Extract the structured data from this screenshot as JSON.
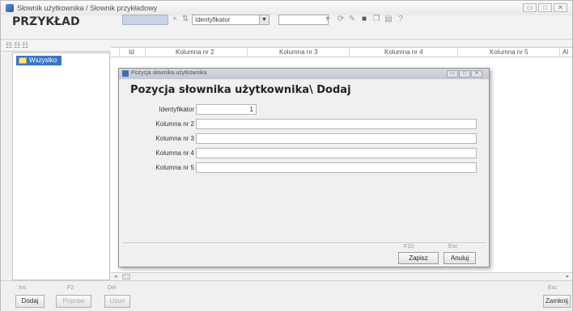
{
  "window": {
    "title": "Słownik użytkownika / Słownik przykładowy",
    "buttons": [
      "▭",
      "□",
      "✕"
    ]
  },
  "brand": "PRZYKŁAD",
  "toolbar": {
    "field_select": "Identyfikator"
  },
  "tree": {
    "item": "Wszystko"
  },
  "grid": {
    "columns": [
      "Id",
      "Kolumna nr 2",
      "Kolumna nr 3",
      "Kolumna nr 4",
      "Kolumna nr 5",
      "Al"
    ]
  },
  "dialog": {
    "title": "Pozycja słownika użytkownika",
    "heading": "Pozycja słownika użytkownika\\ Dodaj",
    "fields": [
      {
        "label": "Identyfikator",
        "value": "1"
      },
      {
        "label": "Kolumna nr 2",
        "value": ""
      },
      {
        "label": "Kolumna nr 3",
        "value": ""
      },
      {
        "label": "Kolumna nr 4",
        "value": ""
      },
      {
        "label": "Kolumna nr 5",
        "value": ""
      }
    ],
    "save_hotkey": "F10",
    "save_label": "Zapisz",
    "cancel_hotkey": "Esc",
    "cancel_label": "Anuluj"
  },
  "bottom": {
    "add_hotkey": "Ins",
    "add_label": "Dodaj",
    "edit_hotkey": "F2",
    "edit_label": "Popraw",
    "delete_hotkey": "Del",
    "delete_label": "Usuń",
    "close_hotkey": "Esc",
    "close_label": "Zamknij"
  }
}
